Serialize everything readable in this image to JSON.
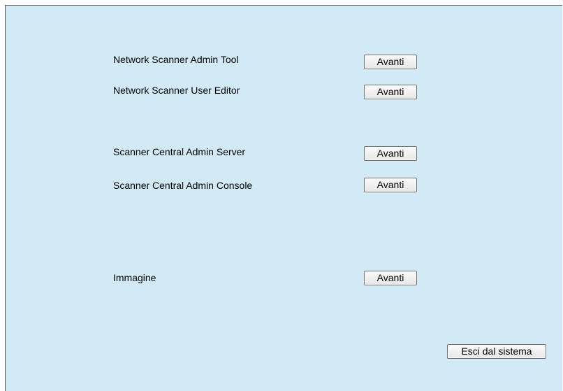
{
  "items": [
    {
      "label": "Network Scanner Admin Tool",
      "button": "Avanti"
    },
    {
      "label": "Network Scanner User Editor",
      "button": "Avanti"
    },
    {
      "label": "Scanner Central Admin Server",
      "button": "Avanti"
    },
    {
      "label": "Scanner Central Admin Console",
      "button": "Avanti"
    },
    {
      "label": "Immagine",
      "button": "Avanti"
    }
  ],
  "logout": {
    "label": "Esci dal sistema"
  },
  "colors": {
    "background": "#d1eaf6",
    "border": "#5a5a5a"
  }
}
